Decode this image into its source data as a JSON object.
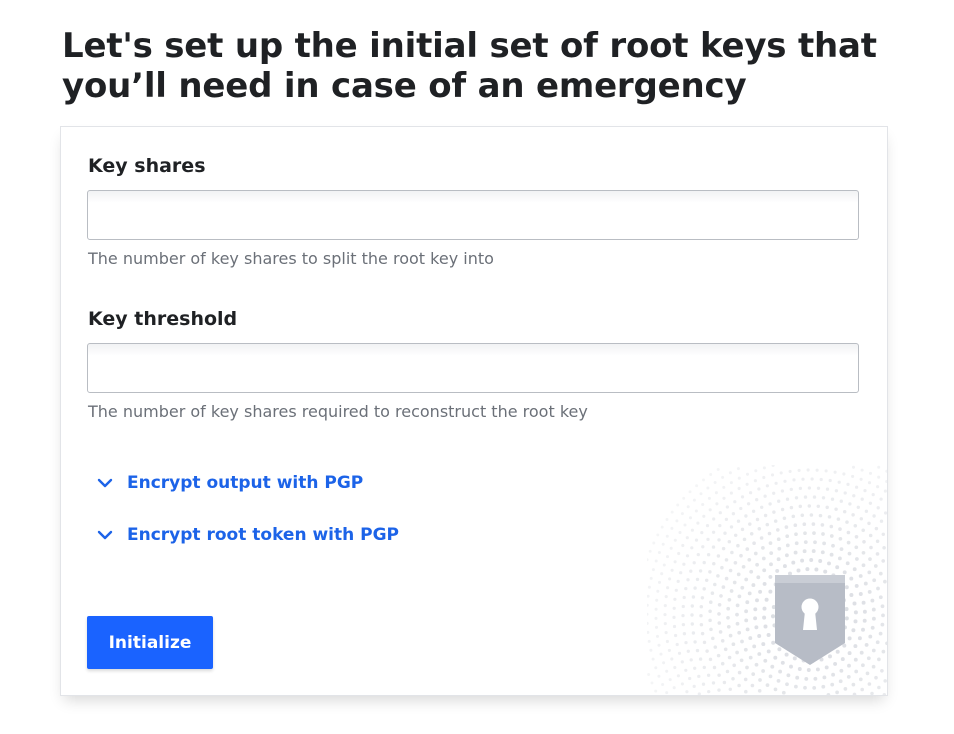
{
  "page": {
    "title": "Let's set up the initial set of root keys that you’ll need in case of an emergency"
  },
  "form": {
    "key_shares": {
      "label": "Key shares",
      "value": "",
      "help": "The number of key shares to split the root key into"
    },
    "key_threshold": {
      "label": "Key threshold",
      "value": "",
      "help": "The number of key shares required to reconstruct the root key"
    },
    "toggles": [
      {
        "label": "Encrypt output with PGP",
        "icon": "chevron-down-icon"
      },
      {
        "label": "Encrypt root token with PGP",
        "icon": "chevron-down-icon"
      }
    ],
    "submit_label": "Initialize"
  },
  "decoration": {
    "icon": "keyhole-shield-icon"
  },
  "colors": {
    "accent": "#1a63ff",
    "link": "#1c63e8",
    "help_text": "#6b7078"
  }
}
